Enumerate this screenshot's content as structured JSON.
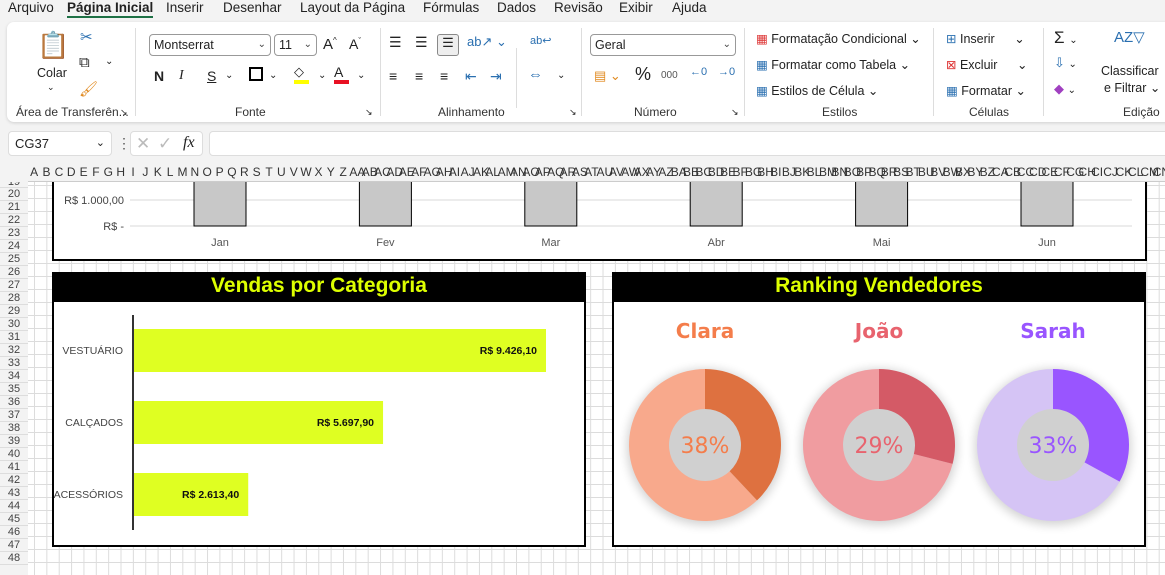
{
  "menu": {
    "tabs": [
      "Arquivo",
      "Página Inicial",
      "Inserir",
      "Desenhar",
      "Layout da Página",
      "Fórmulas",
      "Dados",
      "Revisão",
      "Exibir",
      "Ajuda"
    ],
    "active": "Página Inicial"
  },
  "ribbon": {
    "clipboard": {
      "paste": "Colar",
      "label": "Área de Transferên..."
    },
    "font": {
      "name": "Montserrat",
      "size": "11",
      "bold": "N",
      "italic": "I",
      "underline": "S",
      "grow": "A^",
      "shrink": "Aˇ",
      "label": "Fonte",
      "fill_color": "#FFFF00",
      "font_color": "#E81123"
    },
    "alignment": {
      "label": "Alinhamento"
    },
    "number": {
      "format": "Geral",
      "percent": "%",
      "thousands": "000",
      "label": "Número"
    },
    "styles": {
      "conditional": "Formatação Condicional",
      "table": "Formatar como Tabela",
      "cell": "Estilos de Célula",
      "label": "Estilos"
    },
    "cells": {
      "insert": "Inserir",
      "delete": "Excluir",
      "format": "Formatar",
      "label": "Células"
    },
    "editing": {
      "sort_line1": "Classificar",
      "sort_line2": "e Filtrar",
      "label": "Edição"
    }
  },
  "formula_bar": {
    "name_box": "CG37",
    "formula": ""
  },
  "columns": [
    "A",
    "B",
    "C",
    "D",
    "E",
    "F",
    "G",
    "H",
    "I",
    "J",
    "K",
    "L",
    "M",
    "N",
    "O",
    "P",
    "Q",
    "R",
    "S",
    "T",
    "U",
    "V",
    "W",
    "X",
    "Y",
    "Z",
    "AA",
    "AB",
    "AC",
    "AD",
    "AE",
    "AF",
    "AG",
    "AH",
    "AI",
    "AJ",
    "AK",
    "AL",
    "AM",
    "AN",
    "AO",
    "AP",
    "AQ",
    "AR",
    "AS",
    "AT",
    "AU",
    "AV",
    "AW",
    "AX",
    "AY",
    "AZ",
    "BA",
    "BB",
    "BC",
    "BD",
    "BE",
    "BF",
    "BG",
    "BH",
    "BI",
    "BJ",
    "BK",
    "BL",
    "BM",
    "BN",
    "BO",
    "BP",
    "BQ",
    "BR",
    "BS",
    "BT",
    "BU",
    "BV",
    "BW",
    "BX",
    "BY",
    "BZ",
    "CA",
    "CB",
    "CC",
    "CD",
    "CE",
    "CF",
    "CG",
    "CH",
    "CI",
    "CJ",
    "CK",
    "CL",
    "CM",
    "CN"
  ],
  "rows": [
    "19",
    "20",
    "21",
    "22",
    "23",
    "24",
    "25",
    "26",
    "27",
    "28",
    "29",
    "30",
    "31",
    "32",
    "33",
    "34",
    "35",
    "36",
    "37",
    "38",
    "39",
    "40",
    "41",
    "42",
    "43",
    "44",
    "45",
    "46",
    "47",
    "48"
  ],
  "chart_data": [
    {
      "type": "bar",
      "categories": [
        "Jan",
        "Fev",
        "Mar",
        "Abr",
        "Mai",
        "Jun"
      ],
      "y_tick_labels": [
        "R$ 1.000,00",
        "R$ -"
      ],
      "y_ticks": [
        1000,
        0
      ],
      "bar_color": "#C8C8C8",
      "note_values_above_view": true
    },
    {
      "type": "bar",
      "orientation": "horizontal",
      "title": "Vendas por Categoria",
      "categories": [
        "VESTUÁRIO",
        "CALÇADOS",
        "ACESSÓRIOS"
      ],
      "values": [
        9426.1,
        5697.9,
        2613.4
      ],
      "data_labels": [
        "R$ 9.426,10",
        "R$ 5.697,90",
        "R$ 2.613,40"
      ],
      "bar_color": "#DFFF22"
    },
    {
      "type": "pie",
      "title": "Ranking Vendedores",
      "series": [
        {
          "name": "Clara",
          "value": 38,
          "label": "38%",
          "dark": "#DE7140",
          "light": "#F8A98C",
          "text": "#F47D4B"
        },
        {
          "name": "João",
          "value": 29,
          "label": "29%",
          "dark": "#D45A66",
          "light": "#F09CA0",
          "text": "#E8636E"
        },
        {
          "name": "Sarah",
          "value": 33,
          "label": "33%",
          "dark": "#9955FF",
          "light": "#D5C4F5",
          "text": "#9955FF"
        }
      ]
    }
  ]
}
